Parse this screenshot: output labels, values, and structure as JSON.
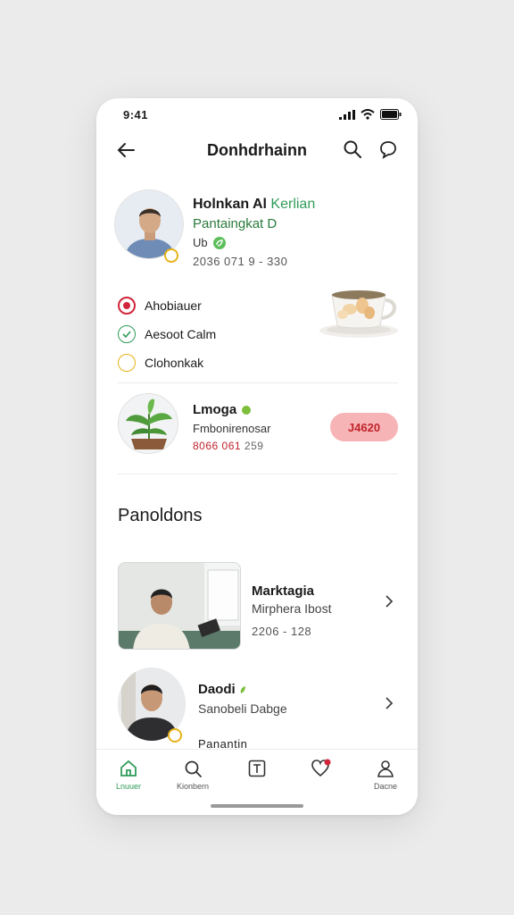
{
  "status": {
    "time": "9:41"
  },
  "header": {
    "title": "Donhdrhainn",
    "back_icon": "arrow-left-icon",
    "search_icon": "search-icon",
    "chat_icon": "chat-bubble-icon"
  },
  "profile": {
    "name": "Holnkan Al ",
    "name_accent": "Kerlian",
    "subtitle": "Pantaingkat D",
    "line3": "Ub",
    "meta": "2036 071 9 - 330"
  },
  "checklist": [
    {
      "label": "Ahobiauer",
      "state": "active",
      "color": "#d0253a"
    },
    {
      "label": "Aesoot Calm",
      "state": "done",
      "color": "#2f9c5a"
    },
    {
      "label": "Clohonkak",
      "state": "pending",
      "color": "#e7b21a"
    }
  ],
  "plant_card": {
    "title": "Lmoga",
    "subtitle": "Fmbonirenosar",
    "meta_red": "8066 061",
    "meta_gray": "259",
    "pill": "J4620"
  },
  "section": {
    "title": "Panoldons"
  },
  "list": [
    {
      "title": "Marktagia",
      "subtitle": "Mirphera Ibost",
      "meta": "2206 - 128"
    },
    {
      "title": "Daodi",
      "subtitle": "Sanobeli Dabge",
      "meta": "Panantin"
    }
  ],
  "tabs": [
    {
      "label": "Lnuuer",
      "icon": "home-icon",
      "active": true
    },
    {
      "label": "Kionbern",
      "icon": "search-icon",
      "active": false
    },
    {
      "label": "",
      "icon": "text-box-icon",
      "active": false
    },
    {
      "label": "",
      "icon": "heart-icon",
      "active": false
    },
    {
      "label": "Dacne",
      "icon": "user-icon",
      "active": false
    }
  ],
  "colors": {
    "accent": "#2f9c5a",
    "alert": "#c0242c",
    "pill_bg": "#f7b4b6"
  }
}
